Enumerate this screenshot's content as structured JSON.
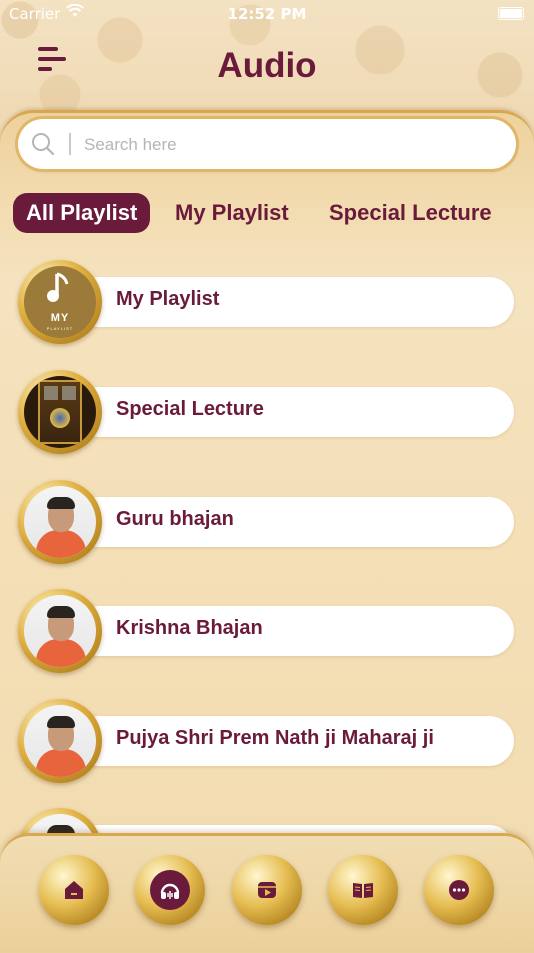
{
  "status_bar": {
    "carrier": "Carrier",
    "time": "12:52 PM"
  },
  "header": {
    "title": "Audio",
    "menu_icon": "menu-icon"
  },
  "search": {
    "placeholder": "Search here",
    "value": "",
    "icon": "search-icon"
  },
  "tabs": [
    {
      "label": "All Playlist",
      "active": true
    },
    {
      "label": "My Playlist",
      "active": false
    },
    {
      "label": "Special Lecture",
      "active": false
    }
  ],
  "playlists": [
    {
      "title": "My Playlist",
      "thumb": "my-playlist",
      "thumb_text": "MY",
      "thumb_sub": "PLAYLIST"
    },
    {
      "title": "Special Lecture",
      "thumb": "lecture-book"
    },
    {
      "title": "Guru bhajan",
      "thumb": "person-photo"
    },
    {
      "title": "Krishna Bhajan",
      "thumb": "person-photo"
    },
    {
      "title": "Pujya Shri Prem Nath ji Maharaj ji",
      "thumb": "person-photo"
    },
    {
      "title": "",
      "thumb": "person-photo"
    }
  ],
  "bottom_nav": [
    {
      "icon": "home-icon",
      "active": false
    },
    {
      "icon": "audio-headphones-icon",
      "active": true
    },
    {
      "icon": "video-icon",
      "active": false
    },
    {
      "icon": "book-icon",
      "active": false
    },
    {
      "icon": "more-icon",
      "active": false
    }
  ],
  "colors": {
    "brand": "#6a1a3a",
    "gold": "#d9a84c",
    "background": "#f1dcb7"
  }
}
